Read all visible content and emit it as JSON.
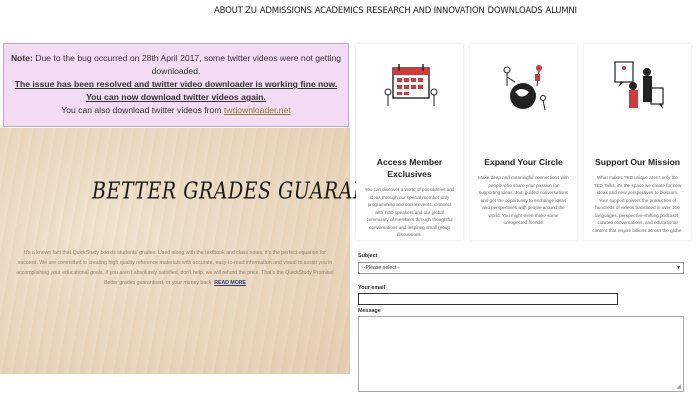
{
  "nav": {
    "items": [
      "ABOUT ZU",
      "ADMISSIONS",
      "ACADEMICS",
      "RESEARCH AND INNOVATION",
      "DOWNLOADS",
      "ALUMNI"
    ]
  },
  "note": {
    "label": "Note:",
    "text1": " Due to the bug occurred on 28th April 2017, some twitter videos were not getting downloaded.",
    "fixed": "The issue has been resolved and twitter video downloader is working fine now. You can now download twitter videos again.",
    "also": "You can also download twitter videos from ",
    "link": "twdownloader.net"
  },
  "banner": {
    "headline": "BETTER GRADES GUARANTEED",
    "para": "It's a known fact that QuickStudy boosts students' grades. Used along with the textbook and class notes, it's the perfect equation for success. We are committed to creating high quality reference materials with accurate, easy-to-read information and visual to assist you in accomplishing your educational goals. If you aren't absolutely satisfied, don't help, we will refund the price. That's the QuickStudy Promise! Better grades guaranteed, or your money back.",
    "read_more": "READ MORE"
  },
  "cards": [
    {
      "title": "Access Member Exclusives",
      "body": "You can discover a world of possibilities and ideas through our special member-only programming and social events. Connect with TED speakers and our global community of members through thoughtful conversations and inspiring small group discussions."
    },
    {
      "title": "Expand Your Circle",
      "body": "Make deep and meaningful connections with people who share your passion for supporting ideas. Join guided conversations and get the opportunity to exchange ideas and perspectives with people around the world. You might even make some unexpected friends!"
    },
    {
      "title": "Support Our Mission",
      "body": "What makes TED unique aren't only the TED Talks, it's the space we create for new ideas and new perspectives to blossom. Your support powers the production of hundreds of videos translated in over 100 languages, perspective-shifting podcasts, curated conversations, and educational content that inspire billions across the globe."
    }
  ],
  "form": {
    "subject_label": "Subject",
    "subject_value": "--Please select--",
    "email_label": "Your email",
    "message_label": "Message"
  },
  "colors": {
    "note_bg": "#f5dcf5",
    "accent_red": "#d23a3a"
  }
}
